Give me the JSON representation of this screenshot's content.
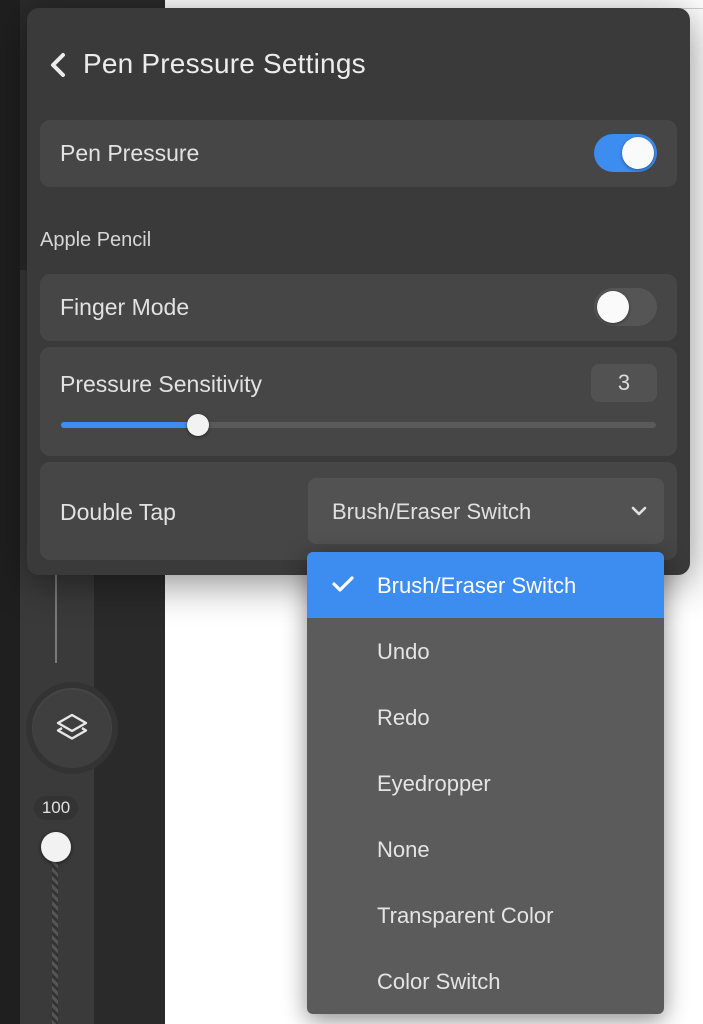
{
  "panel": {
    "title": "Pen Pressure Settings",
    "pen_pressure": {
      "label": "Pen Pressure",
      "enabled": true
    },
    "section_label": "Apple Pencil",
    "finger_mode": {
      "label": "Finger Mode",
      "enabled": false
    },
    "pressure_sensitivity": {
      "label": "Pressure Sensitivity",
      "value": "3",
      "level_fraction": 0.23
    },
    "double_tap": {
      "label": "Double Tap",
      "selected": "Brush/Eraser Switch"
    }
  },
  "dropdown": {
    "items": [
      {
        "label": "Brush/Eraser Switch",
        "selected": true
      },
      {
        "label": "Undo",
        "selected": false
      },
      {
        "label": "Redo",
        "selected": false
      },
      {
        "label": "Eyedropper",
        "selected": false
      },
      {
        "label": "None",
        "selected": false
      },
      {
        "label": "Transparent Color",
        "selected": false
      },
      {
        "label": "Color Switch",
        "selected": false
      }
    ]
  },
  "side_rail": {
    "opacity_value": "100"
  },
  "colors": {
    "accent": "#3d8cf0",
    "panel_bg": "#3a3a3a",
    "row_bg": "#464646",
    "menu_bg": "#5b5b5b"
  }
}
